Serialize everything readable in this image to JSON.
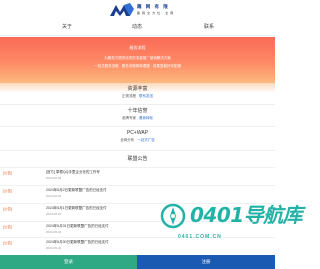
{
  "header": {
    "logo_name": "趣 网 有 限",
    "logo_sub": "趣 网 全 方 位 · 全 网",
    "nav": [
      {
        "label": "关于"
      },
      {
        "label": "动态"
      },
      {
        "label": "联系"
      }
    ]
  },
  "banner": {
    "title": "服务流程",
    "lines": [
      "为服务方提供优质的流量推广营销解决方案",
      "一站式服务流程 · 服务流程简单便捷 · 效果显著好评如潮"
    ]
  },
  "sections": [
    {
      "title": "资源丰富",
      "text": "正规流程",
      "link": "联系发送"
    },
    {
      "title": "十年信誉",
      "text": "老牌专家",
      "link": "看我转帐"
    },
    {
      "title": "PC+WAP",
      "text": "全网分布",
      "link": "一站式广告"
    }
  ],
  "notices": {
    "title": "联盟公告",
    "items": [
      {
        "tag": "[公告]",
        "title": "[官方] 草根QQ手里企业化的工作号",
        "date": "2024-06-03"
      },
      {
        "tag": "[公告]",
        "title": "2024年6月2日更新联盟广告的已经支付",
        "date": "2024-06-02"
      },
      {
        "tag": "[公告]",
        "title": "2024年6月1日更新联盟广告的已经支付",
        "date": "2024-06-01"
      },
      {
        "tag": "[公告]",
        "title": "2024年5月31日更新联盟广告的已经支付",
        "date": "2024-05-31"
      },
      {
        "tag": "[公告]",
        "title": "2024年5月30日更新联盟广告的已经支付",
        "date": "2024-05-30"
      }
    ]
  },
  "watermark": {
    "text": "0401导航库",
    "url": "0401.COM.CN"
  },
  "footer": {
    "login": "登录",
    "register": "注册"
  },
  "colors": {
    "banner_top": "#fb6a56",
    "banner_bottom": "#fdb97f",
    "accent_link": "#2f6fd6",
    "notice_tag": "#e0602b",
    "login_bg": "#2fa884",
    "register_bg": "#1b5ab3",
    "watermark": "#22b3a6"
  }
}
